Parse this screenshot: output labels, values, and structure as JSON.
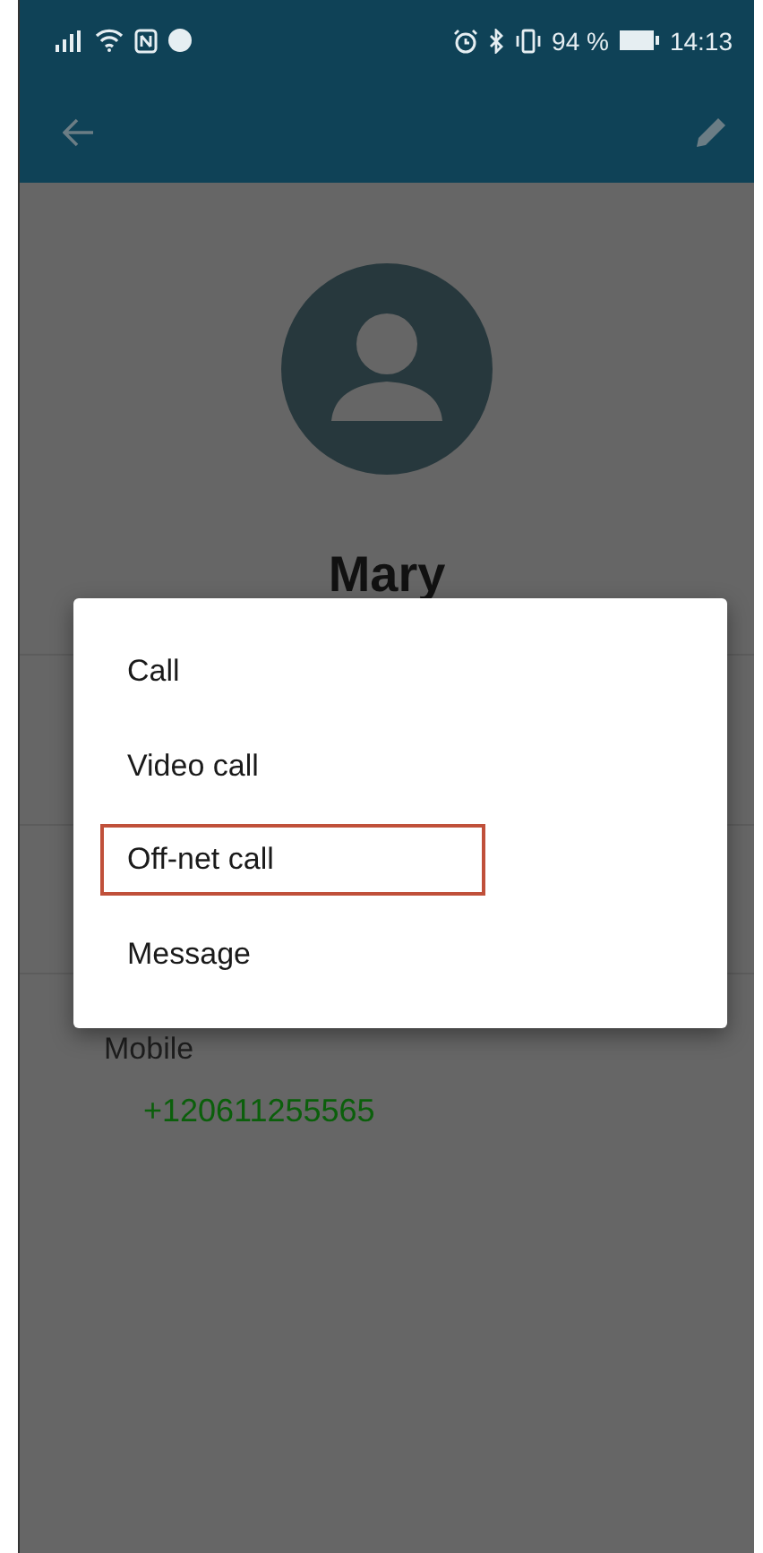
{
  "status_bar": {
    "battery_percent": "94 %",
    "time": "14:13"
  },
  "contact": {
    "name": "Mary",
    "phone_label": "Mobile",
    "phone_number": "+120611255565"
  },
  "dialog": {
    "items": [
      {
        "label": "Call",
        "highlighted": false
      },
      {
        "label": "Video call",
        "highlighted": false
      },
      {
        "label": "Off-net call",
        "highlighted": true
      },
      {
        "label": "Message",
        "highlighted": false
      }
    ]
  }
}
